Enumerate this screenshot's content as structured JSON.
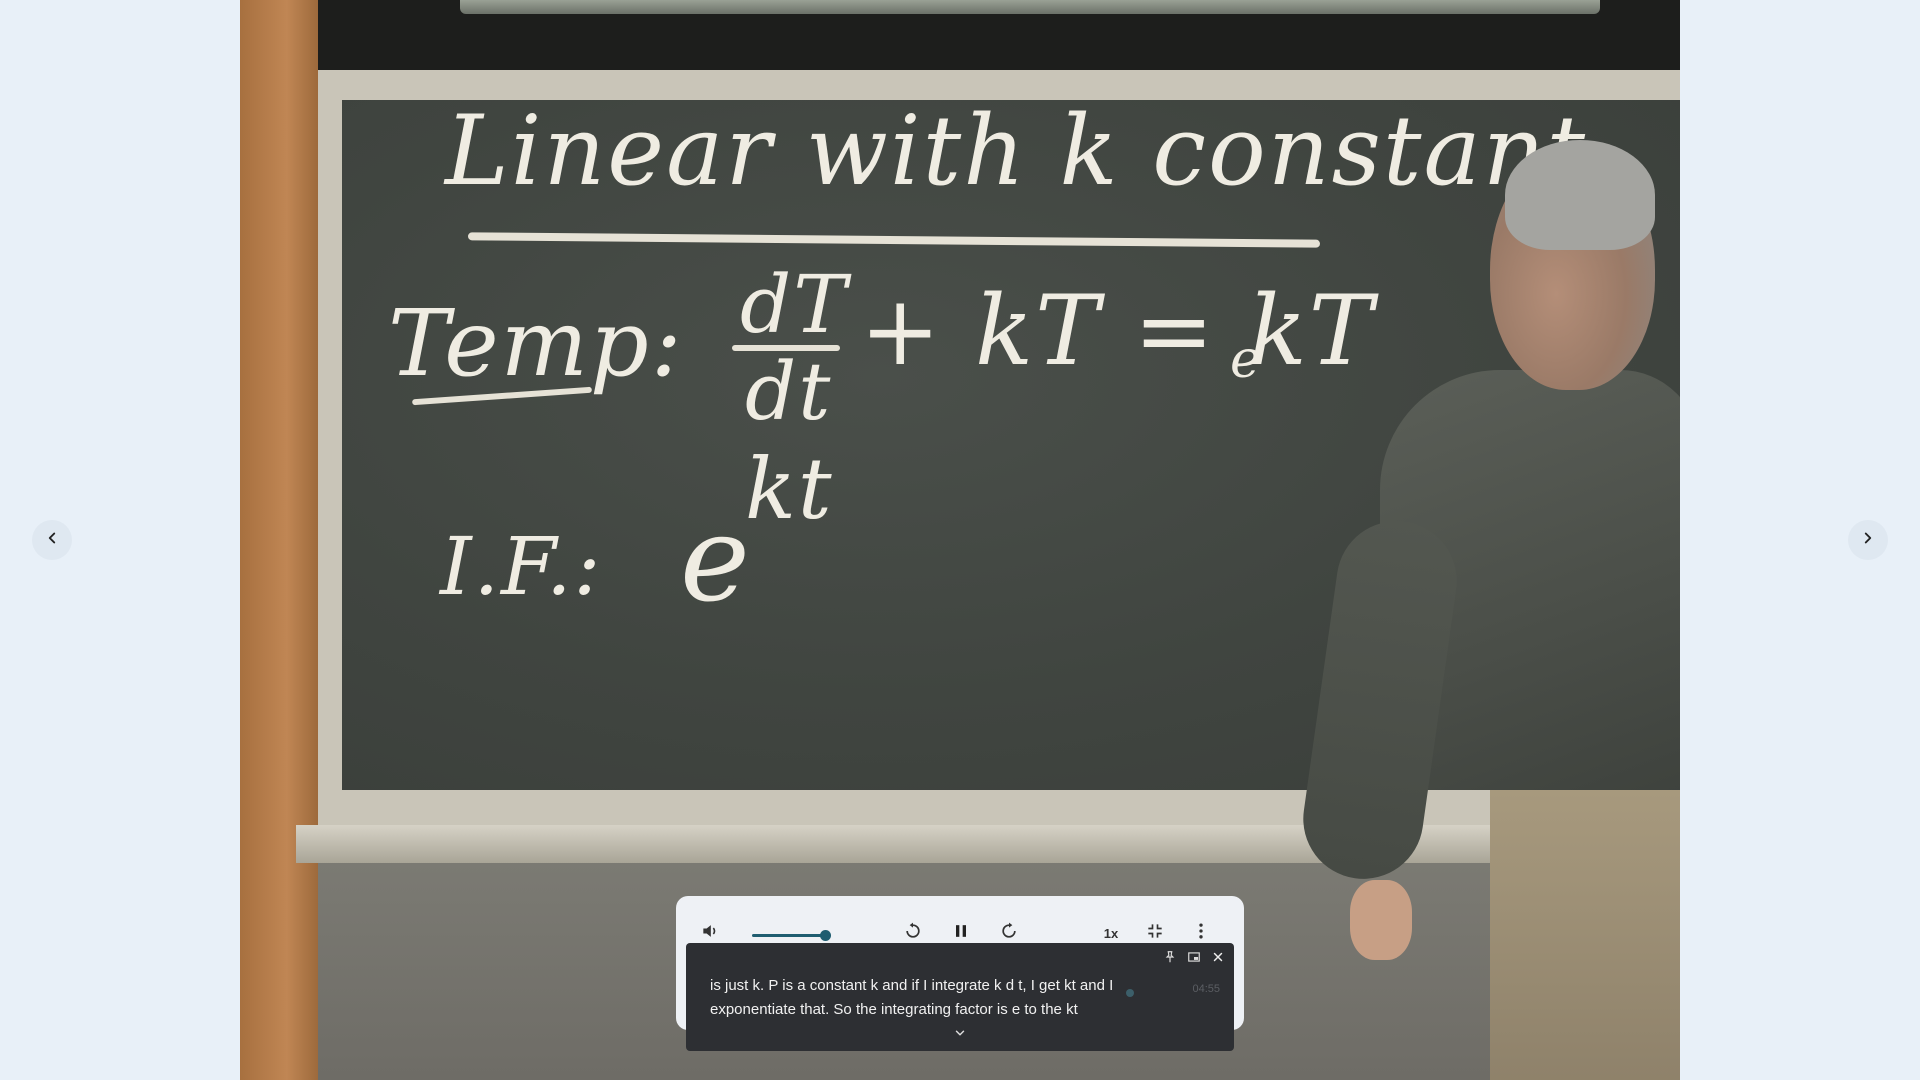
{
  "video": {
    "board_title": "Linear with k constant",
    "temp_label": "Temp:",
    "eq_numerator": "dT",
    "eq_denominator": "dt",
    "eq_rest": "+ kT = kT",
    "eq_subscript": "e",
    "if_label": "I.F.:",
    "if_base": "e",
    "if_exponent": "kt"
  },
  "nav": {
    "prev_icon": "chevron-left-icon",
    "next_icon": "chevron-right-icon"
  },
  "player": {
    "volume_icon": "volume-icon",
    "volume_level": 0.9,
    "rewind_icon": "rewind-10-icon",
    "play_state_icon": "pause-icon",
    "forward_icon": "forward-10-icon",
    "speed_label": "1x",
    "exit_fullscreen_icon": "fullscreen-exit-icon",
    "more_icon": "more-vertical-icon",
    "accent_color": "#1f5d70"
  },
  "captions": {
    "text": "is just k. P is a constant k and if I integrate k d t, I get kt and I exponentiate that. So the integrating factor is e to the kt",
    "timestamp": "04:55",
    "pin_icon": "pin-icon",
    "popout_icon": "picture-in-picture-icon",
    "close_icon": "close-icon",
    "expand_icon": "chevron-down-icon"
  }
}
